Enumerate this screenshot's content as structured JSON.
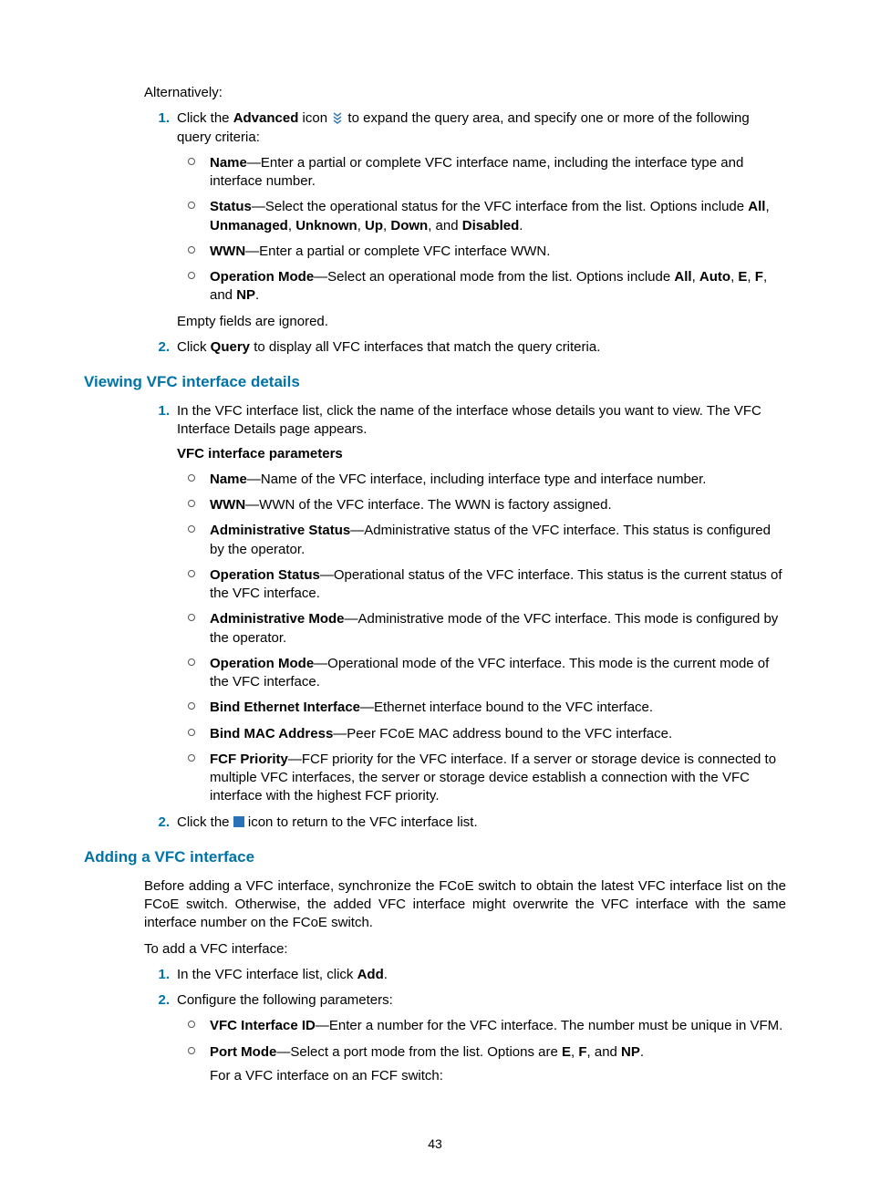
{
  "intro": {
    "alt_label": "Alternatively:"
  },
  "alt_steps": {
    "s1_pre": "Click the ",
    "s1_bold": "Advanced",
    "s1_mid": " icon ",
    "s1_post": " to expand the query area, and specify one or more of the following query criteria:",
    "criteria": {
      "name": {
        "t": "Name",
        "d": "—Enter a partial or complete VFC interface name, including the interface type and interface number."
      },
      "status": {
        "t": "Status",
        "d1": "—Select the operational status for the VFC interface from the list. Options include ",
        "b1": "All",
        "c1": ", ",
        "b2": "Unmanaged",
        "c2": ", ",
        "b3": "Unknown",
        "c3": ", ",
        "b4": "Up",
        "c4": ", ",
        "b5": "Down",
        "c5": ", and ",
        "b6": "Disabled",
        "c6": "."
      },
      "wwn": {
        "t": "WWN",
        "d": "—Enter a partial or complete VFC interface WWN."
      },
      "opmode": {
        "t": "Operation Mode",
        "d1": "—Select an operational mode from the list. Options include ",
        "b1": "All",
        "c1": ", ",
        "b2": "Auto",
        "c2": ", ",
        "b3": "E",
        "c3": ", ",
        "b4": "F",
        "c4": ", and ",
        "b5": "NP",
        "c5": "."
      }
    },
    "empty_note": "Empty fields are ignored.",
    "s2_pre": "Click ",
    "s2_bold": "Query",
    "s2_post": " to display all VFC interfaces that match the query criteria."
  },
  "sec_view": {
    "title": "Viewing VFC interface details",
    "s1": "In the VFC interface list, click the name of the interface whose details you want to view. The VFC Interface Details page appears.",
    "params_heading": "VFC interface parameters",
    "params": {
      "name": {
        "t": "Name",
        "d": "—Name of the VFC interface, including interface type and interface number."
      },
      "wwn": {
        "t": "WWN",
        "d": "—WWN of the VFC interface. The WWN is factory assigned."
      },
      "adminstat": {
        "t": "Administrative Status",
        "d": "—Administrative status of the VFC interface. This status is configured by the operator."
      },
      "opstat": {
        "t": "Operation Status",
        "d": "—Operational status of the VFC interface. This status is the current status of the VFC interface."
      },
      "adminmode": {
        "t": "Administrative Mode",
        "d": "—Administrative mode of the VFC interface. This mode is configured by the operator."
      },
      "opmode": {
        "t": "Operation Mode",
        "d": "—Operational mode of the VFC interface. This mode is the current mode of the VFC interface."
      },
      "bindeth": {
        "t": "Bind Ethernet Interface",
        "d": "—Ethernet interface bound to the VFC interface."
      },
      "bindmac": {
        "t": "Bind MAC Address",
        "d": "—Peer FCoE MAC address bound to the VFC interface."
      },
      "fcf": {
        "t": "FCF Priority",
        "d": "—FCF priority for the VFC interface. If a server or storage device is connected to multiple VFC interfaces, the server or storage device establish a connection with the VFC interface with the highest FCF priority."
      }
    },
    "s2_pre": "Click the ",
    "s2_post": " icon to return to the VFC interface list."
  },
  "sec_add": {
    "title": "Adding a VFC interface",
    "intro": "Before adding a VFC interface, synchronize the FCoE switch to obtain the latest VFC interface list on the FCoE switch. Otherwise, the added VFC interface might overwrite the VFC interface with the same interface number on the FCoE switch.",
    "lead": "To add a VFC interface:",
    "s1_pre": "In the VFC interface list, click ",
    "s1_bold": "Add",
    "s1_post": ".",
    "s2": "Configure the following parameters:",
    "params": {
      "vfcid": {
        "t": "VFC Interface ID",
        "d": "—Enter a number for the VFC interface. The number must be unique in VFM."
      },
      "portmode": {
        "t": "Port Mode",
        "d1": "—Select a port mode from the list. Options are ",
        "b1": "E",
        "c1": ", ",
        "b2": "F",
        "c2": ", and ",
        "b3": "NP",
        "c3": ".",
        "sub": "For a VFC interface on an FCF switch:"
      }
    }
  },
  "page_number": "43"
}
